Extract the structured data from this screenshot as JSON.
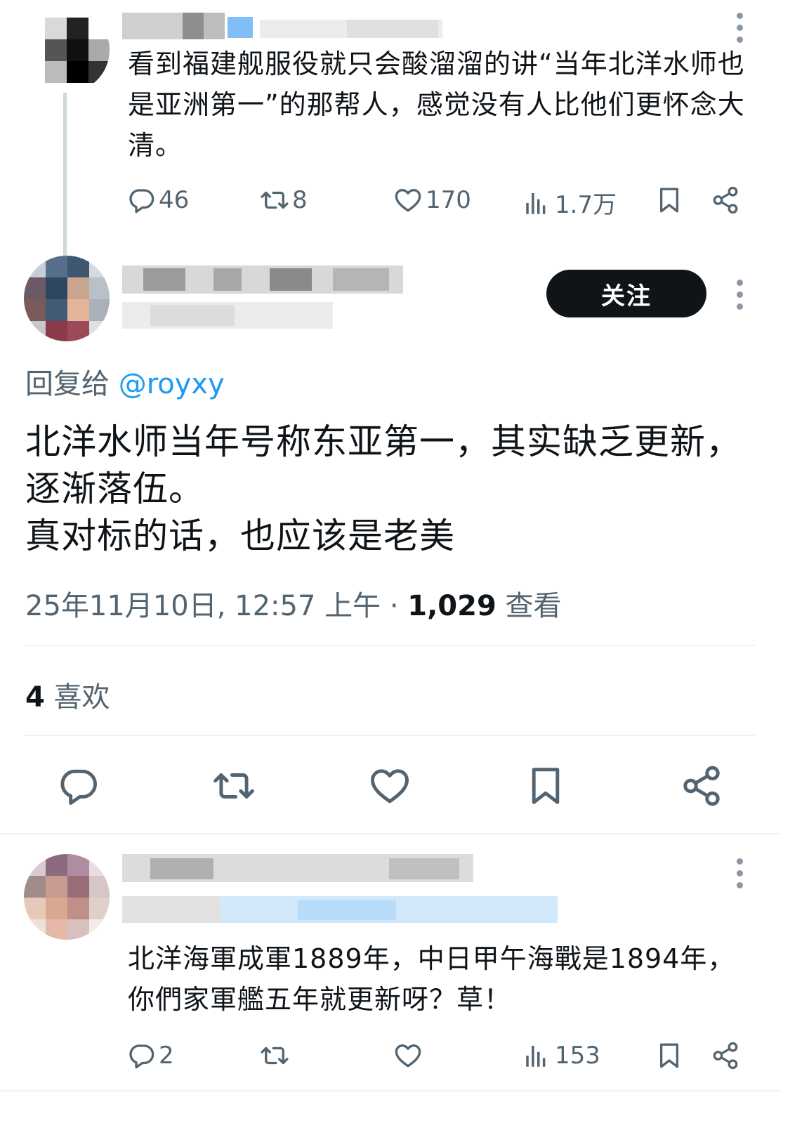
{
  "tweet1": {
    "text": "看到福建舰服役就只会酸溜溜的讲“当年北洋水师也是亚洲第一”的那帮人，感觉没有人比他们更怀念大清。",
    "replies": "46",
    "retweets": "8",
    "likes": "170",
    "views": "1.7万"
  },
  "main_tweet": {
    "follow_label": "关注",
    "reply_to_prefix": "回复给",
    "reply_to_handle": "@royxy",
    "text_line1": "北洋水师当年号称东亚第一，其实缺乏更新，",
    "text_line2": "逐渐落伍。",
    "text_line3": "真对标的话，也应该是老美",
    "timestamp": "25年11月10日, 12:57 上午 · ",
    "view_count": "1,029",
    "view_label": " 查看",
    "like_count": "4",
    "like_label": " 喜欢"
  },
  "tweet3": {
    "text": "北洋海軍成軍1889年，中日甲午海戰是1894年，你們家軍艦五年就更新呀？草！",
    "replies": "2",
    "retweets": "",
    "likes": "",
    "views": "153"
  },
  "icons": [
    "reply-icon",
    "retweet-icon",
    "like-icon",
    "views-icon",
    "bookmark-icon",
    "share-icon",
    "more-icon"
  ],
  "colors": {
    "text": "#0f1419",
    "secondary": "#536471",
    "link": "#1d9bf0",
    "divider": "#eff3f4",
    "button": "#0f1419"
  }
}
